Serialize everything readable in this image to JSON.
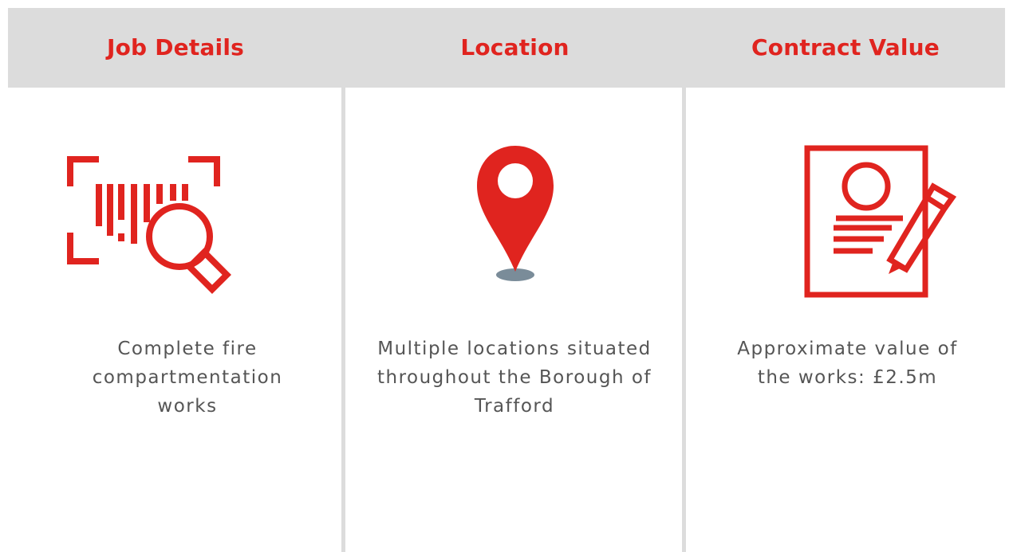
{
  "colors": {
    "accent": "#e0241f",
    "header_background": "#dcdcdc",
    "divider": "#dcdcdc",
    "body_text": "#555555",
    "pin_base": "#7a8c99"
  },
  "columns": [
    {
      "title": "Job Details",
      "icon": "barcode-search-icon",
      "text": "Complete fire compartmentation works"
    },
    {
      "title": "Location",
      "icon": "map-pin-icon",
      "text": "Multiple locations situated throughout the Borough of Trafford"
    },
    {
      "title": "Contract Value",
      "icon": "contract-document-icon",
      "text": "Approximate value of the works: £2.5m"
    }
  ]
}
